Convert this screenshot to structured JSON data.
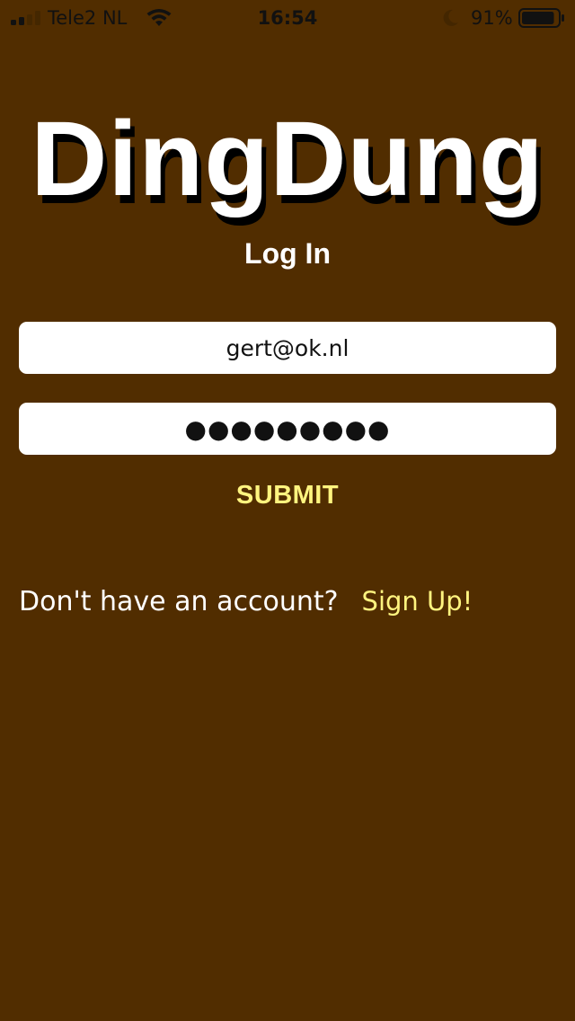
{
  "status_bar": {
    "carrier": "Tele2 NL",
    "time": "16:54",
    "battery_percent": "91%",
    "signal_bars_filled": 2,
    "signal_bars_total": 4,
    "battery_level": 0.91,
    "icons": [
      "signal-bars-icon",
      "wifi-icon",
      "moon-icon",
      "battery-icon"
    ]
  },
  "app": {
    "logo": "DingDung",
    "title": "Log In"
  },
  "form": {
    "email_value": "gert@ok.nl",
    "password_value": "●●●●●●●●●",
    "submit_label": "SUBMIT"
  },
  "signup": {
    "prompt": "Don't have an account?",
    "link_label": "Sign Up!"
  },
  "colors": {
    "background": "#512d00",
    "accent": "#fff47f",
    "text": "#ffffff",
    "field_bg": "#ffffff"
  }
}
